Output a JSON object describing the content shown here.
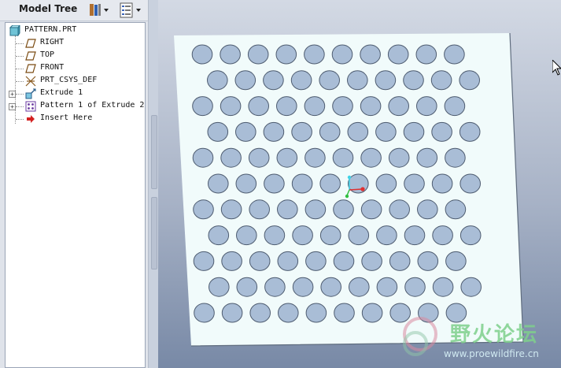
{
  "model_tree": {
    "title": "Model Tree",
    "items": [
      {
        "label": "PATTERN.PRT",
        "icon": "part-icon",
        "expandable": false
      },
      {
        "label": "RIGHT",
        "icon": "datum-plane-icon",
        "expandable": false
      },
      {
        "label": "TOP",
        "icon": "datum-plane-icon",
        "expandable": false
      },
      {
        "label": "FRONT",
        "icon": "datum-plane-icon",
        "expandable": false
      },
      {
        "label": "PRT_CSYS_DEF",
        "icon": "coordinate-system-icon",
        "expandable": false
      },
      {
        "label": "Extrude 1",
        "icon": "extrude-icon",
        "expandable": true
      },
      {
        "label": "Pattern 1 of Extrude 2",
        "icon": "pattern-icon",
        "expandable": true
      },
      {
        "label": "Insert Here",
        "icon": "insert-arrow-icon",
        "expandable": false
      }
    ]
  },
  "toolbar": {
    "settings_icon": "tools-icon",
    "show_icon": "tree-columns-icon"
  },
  "plate": {
    "color": "#f1fbfb",
    "hole_color": "#a9bdd6",
    "rows": 11,
    "cols_even_rows": 10,
    "cols_odd_rows": 10
  },
  "watermark": {
    "text_cn": "野火论坛",
    "url": "www.proewildfire.cn"
  }
}
